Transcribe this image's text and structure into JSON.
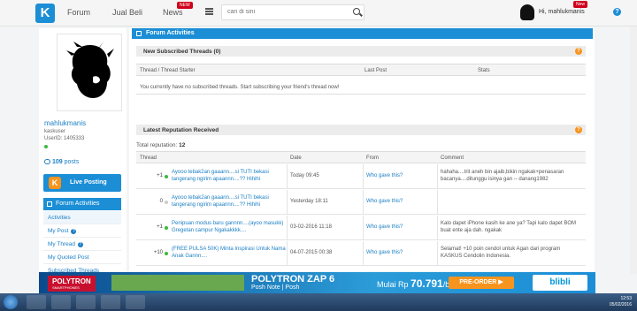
{
  "nav": {
    "logo": "K",
    "forum": "Forum",
    "jual_beli": "Jual Beli",
    "news": "News",
    "news_badge": "NEW",
    "search_placeholder": "cari di sini",
    "user_badge": "New",
    "greeting": "Hi, mahlukmanis",
    "help": "?"
  },
  "profile": {
    "username": "mahlukmanis",
    "role": "kaskuser",
    "user_id": "UserID: 1405333",
    "posts_count": "109",
    "posts_label": "posts",
    "live_posting": "Live Posting",
    "menu_title": "Forum Activities",
    "menu": [
      {
        "label": "Activities"
      },
      {
        "label": "My Post"
      },
      {
        "label": "My Thread"
      },
      {
        "label": "My Quoted Post"
      },
      {
        "label": "Subscribed Threads"
      }
    ]
  },
  "main": {
    "title": "Forum Activities",
    "subscribed": {
      "title": "New Subscribed Threads (0)",
      "columns": [
        "Thread / Thread Starter",
        "Last Post",
        "Stats"
      ],
      "empty_message": "You currently have no subscribed threads. Start subscribing your friend's thread now!"
    },
    "reputation": {
      "title": "Latest Reputation Received",
      "total_label": "Total reputation:",
      "total_value": "12",
      "columns": [
        "Thread",
        "Date",
        "From",
        "Comment"
      ],
      "rows": [
        {
          "points": "+1",
          "dot": "#3cb93c",
          "thread": "Ayooo tebak2an gaaann....si TUTI bekasi tangerang ngirim apaannn....?? Hihihi",
          "date": "Today 09:45",
          "from": "Who gave this?",
          "comment": "hahaha....trit aneh bin ajaib,bikin ngakak+penasaran bacanya....ditunggu isinya gan -- danang1982"
        },
        {
          "points": "0",
          "dot": "#cccccc",
          "thread": "Ayooo tebak2an gaaann....si TUTI bekasi tangerang ngirim apaannn....?? Hihihi",
          "date": "Yesterday 18:11",
          "from": "Who gave this?",
          "comment": ""
        },
        {
          "points": "+1",
          "dot": "#3cb93c",
          "thread": "Penipuan modus baru gannnn....(ayoo masukk) Gregetan campur Ngakakkkk....",
          "date": "03-02-2016 11:18",
          "from": "Who gave this?",
          "comment": "Kalo dapet iPhone kasih ke ane ya? Tapi kalo dapet BOM buat ente aja dah. ngakak"
        },
        {
          "points": "+10",
          "dot": "#3cb93c",
          "thread": "(FREE PULSA 50K) Minta Inspirasi Untuk Nama Anak Gannn....",
          "date": "04-07-2015 00:38",
          "from": "Who gave this?",
          "comment": "Selamat! +10 poin cendol untuk Agan dari program KASKUS Cendolin Indonesia."
        }
      ]
    }
  },
  "ad": {
    "brand": "POLYTRON",
    "brand_sub": "SMARTPHONES",
    "title": "POLYTRON ZAP 6",
    "subtitle": "Posh Note | Posh",
    "price_prefix": "Mulai Rp",
    "price": "70.791",
    "price_suffix": "/bln*",
    "cta": "PRE-ORDER ▶",
    "partner": "blibli"
  },
  "taskbar": {
    "time": "12:53",
    "date": "05/02/2016"
  }
}
